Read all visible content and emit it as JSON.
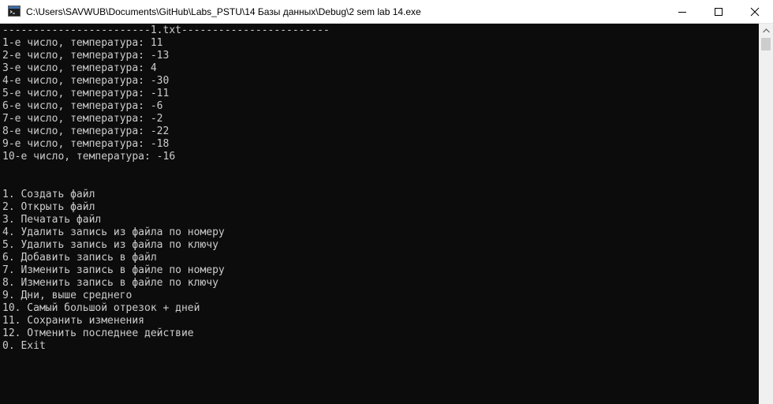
{
  "window": {
    "title": "C:\\Users\\SAVWUB\\Documents\\GitHub\\Labs_PSTU\\14 Базы данных\\Debug\\2 sem lab 14.exe",
    "icon": "console-app-icon",
    "controls": {
      "minimize_icon": "minimize-icon",
      "maximize_icon": "maximize-icon",
      "close_icon": "close-icon"
    }
  },
  "console": {
    "lines": [
      "------------------------1.txt------------------------",
      "1-е число, температура: 11",
      "2-е число, температура: -13",
      "3-е число, температура: 4",
      "4-е число, температура: -30",
      "5-е число, температура: -11",
      "6-е число, температура: -6",
      "7-е число, температура: -2",
      "8-е число, температура: -22",
      "9-е число, температура: -18",
      "10-е число, температура: -16",
      "",
      "",
      "1. Создать файл",
      "2. Открыть файл",
      "3. Печатать файл",
      "4. Удалить запись из файла по номеру",
      "5. Удалить запись из файла по ключу",
      "6. Добавить запись в файл",
      "7. Изменить запись в файле по номеру",
      "8. Изменить запись в файле по ключу",
      "9. Дни, выше среднего",
      "10. Самый большой отрезок + дней",
      "11. Сохранить изменения",
      "12. Отменить последнее действие",
      "0. Exit"
    ]
  },
  "colors": {
    "console_background": "#0c0c0c",
    "console_text": "#cccccc",
    "titlebar_background": "#ffffff"
  }
}
